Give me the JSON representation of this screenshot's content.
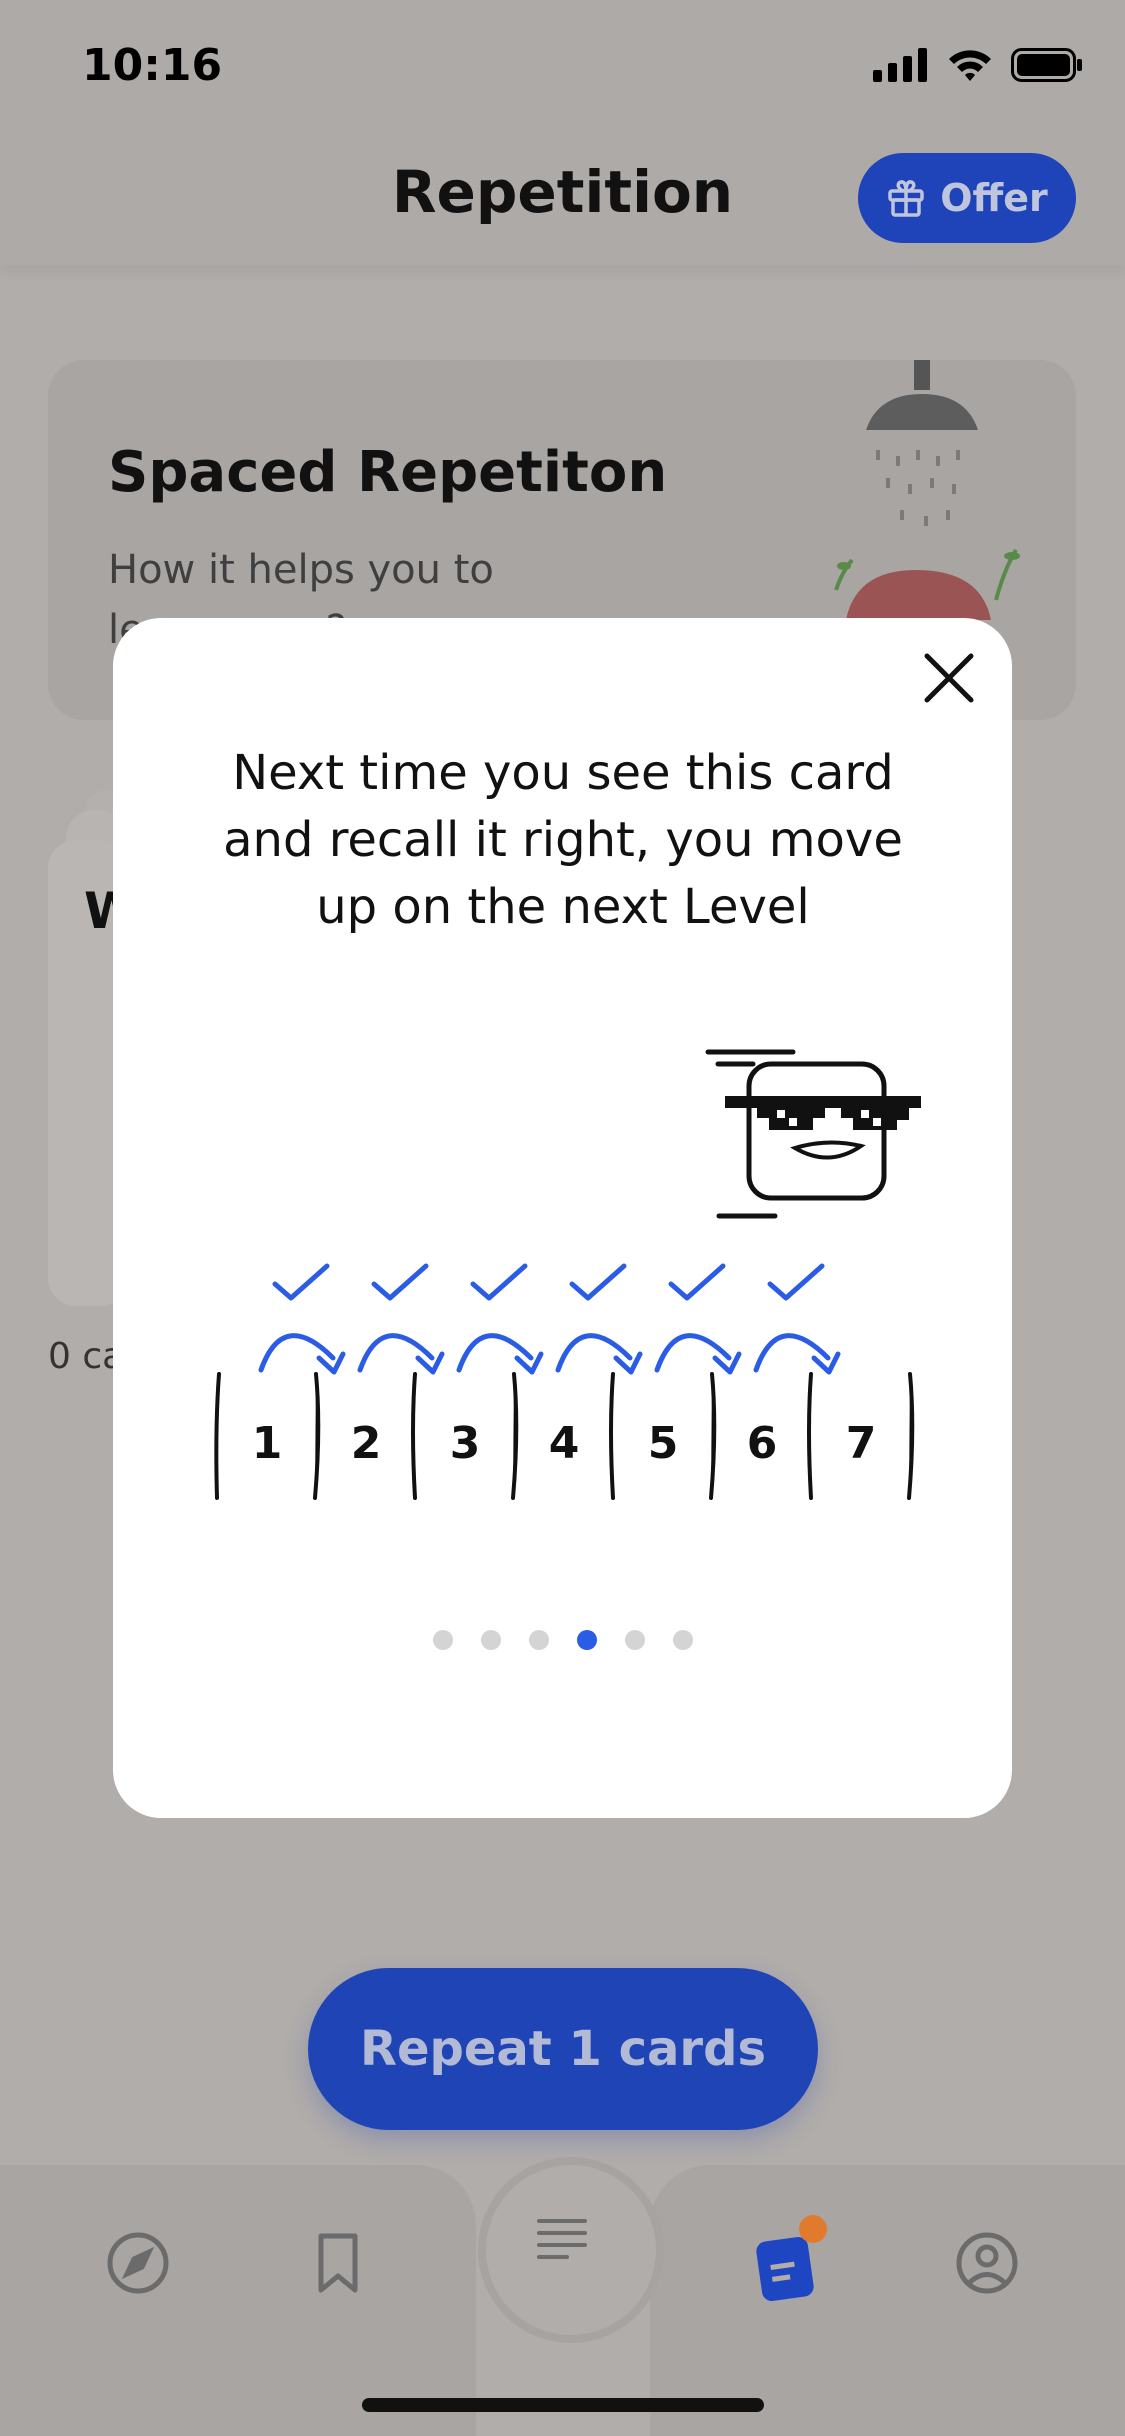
{
  "status_bar": {
    "time": "10:16"
  },
  "header": {
    "title": "Repetition",
    "offer_label": "Offer"
  },
  "info_card": {
    "title": "Spaced Repetiton",
    "subtitle": "How it helps you to learn more?"
  },
  "deck": {
    "title_initial": "W",
    "count_text": "0 ca"
  },
  "modal": {
    "text": "Next time you see this card and recall it right, you move up on the next Level",
    "levels": [
      "1",
      "2",
      "3",
      "4",
      "5",
      "6",
      "7"
    ],
    "page_count": 6,
    "active_page": 4
  },
  "cta": {
    "repeat_label": "Repeat 1 cards"
  },
  "tabbar": {
    "items": [
      {
        "icon": "compass-icon"
      },
      {
        "icon": "bookmark-icon"
      },
      {
        "icon": "menu-lines-icon"
      },
      {
        "icon": "learn-cards-icon"
      },
      {
        "icon": "profile-icon"
      }
    ],
    "badge_color": "#e07b2e"
  },
  "colors": {
    "accent": "#2b5ce6",
    "button": "#1e44b5"
  }
}
